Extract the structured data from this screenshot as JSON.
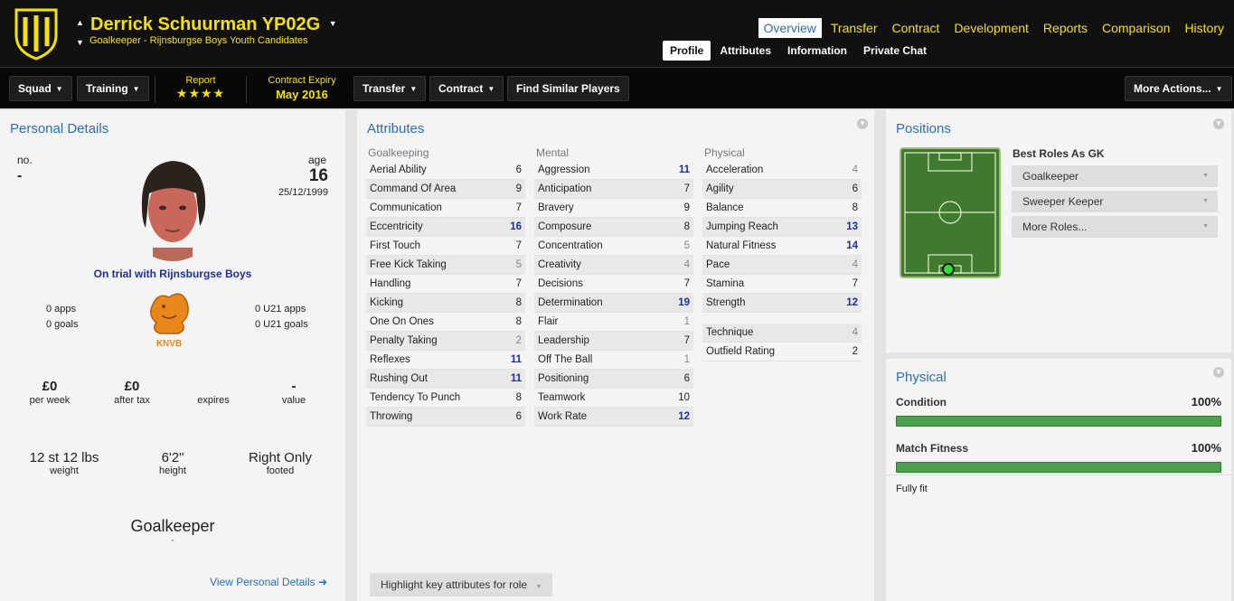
{
  "header": {
    "name": "Derrick Schuurman YP02G",
    "subtitle": "Goalkeeper - Rijnsburgse Boys Youth Candidates",
    "tabs": [
      {
        "label": "Overview",
        "active": true
      },
      {
        "label": "Transfer"
      },
      {
        "label": "Contract"
      },
      {
        "label": "Development"
      },
      {
        "label": "Reports"
      },
      {
        "label": "Comparison"
      },
      {
        "label": "History"
      }
    ],
    "subtabs": [
      {
        "label": "Profile",
        "active": true
      },
      {
        "label": "Attributes"
      },
      {
        "label": "Information"
      },
      {
        "label": "Private Chat"
      }
    ],
    "brand_color": "#f5e200"
  },
  "toolbar": {
    "squad": "Squad",
    "training": "Training",
    "report_label": "Report",
    "report_stars": "★★★★",
    "contract_label": "Contract Expiry",
    "contract_value": "May 2016",
    "transfer": "Transfer",
    "contract": "Contract",
    "find_similar": "Find Similar Players",
    "more_actions": "More Actions..."
  },
  "personal": {
    "title": "Personal Details",
    "no_label": "no.",
    "no_value": "-",
    "age_label": "age",
    "age_value": "16",
    "dob": "25/12/1999",
    "trial": "On trial with Rijnsburgse Boys",
    "apps": "0 apps",
    "goals": "0 goals",
    "u21_apps": "0 U21 apps",
    "u21_goals": "0 U21 goals",
    "badge_text": "KNVB",
    "wage": "£0",
    "wage_label": "per week",
    "after_tax": "£0",
    "after_tax_label": "after tax",
    "expires_label": "expires",
    "value": "-",
    "value_label": "value",
    "weight": "12 st 12 lbs",
    "weight_label": "weight",
    "height": "6'2\"",
    "height_label": "height",
    "foot": "Right Only",
    "foot_label": "footed",
    "position": "Goalkeeper",
    "position_sub": "-",
    "view_link": "View Personal Details ➜"
  },
  "attributes": {
    "title": "Attributes",
    "goalkeeping_head": "Goalkeeping",
    "mental_head": "Mental",
    "physical_head": "Physical",
    "goalkeeping": [
      {
        "name": "Aerial Ability",
        "value": "6"
      },
      {
        "name": "Command Of Area",
        "value": "9"
      },
      {
        "name": "Communication",
        "value": "7"
      },
      {
        "name": "Eccentricity",
        "value": "16",
        "level": "hi"
      },
      {
        "name": "First Touch",
        "value": "7"
      },
      {
        "name": "Free Kick Taking",
        "value": "5",
        "level": "lo"
      },
      {
        "name": "Handling",
        "value": "7"
      },
      {
        "name": "Kicking",
        "value": "8"
      },
      {
        "name": "One On Ones",
        "value": "8"
      },
      {
        "name": "Penalty Taking",
        "value": "2",
        "level": "lo"
      },
      {
        "name": "Reflexes",
        "value": "11",
        "level": "hi"
      },
      {
        "name": "Rushing Out",
        "value": "11",
        "level": "hi"
      },
      {
        "name": "Tendency To Punch",
        "value": "8"
      },
      {
        "name": "Throwing",
        "value": "6"
      }
    ],
    "mental": [
      {
        "name": "Aggression",
        "value": "11",
        "level": "hi"
      },
      {
        "name": "Anticipation",
        "value": "7"
      },
      {
        "name": "Bravery",
        "value": "9"
      },
      {
        "name": "Composure",
        "value": "8"
      },
      {
        "name": "Concentration",
        "value": "5",
        "level": "lo"
      },
      {
        "name": "Creativity",
        "value": "4",
        "level": "lo"
      },
      {
        "name": "Decisions",
        "value": "7"
      },
      {
        "name": "Determination",
        "value": "19",
        "level": "hi"
      },
      {
        "name": "Flair",
        "value": "1",
        "level": "lo"
      },
      {
        "name": "Leadership",
        "value": "7"
      },
      {
        "name": "Off The Ball",
        "value": "1",
        "level": "lo"
      },
      {
        "name": "Positioning",
        "value": "6"
      },
      {
        "name": "Teamwork",
        "value": "10"
      },
      {
        "name": "Work Rate",
        "value": "12",
        "level": "hi"
      }
    ],
    "physical": [
      {
        "name": "Acceleration",
        "value": "4",
        "level": "lo"
      },
      {
        "name": "Agility",
        "value": "6"
      },
      {
        "name": "Balance",
        "value": "8"
      },
      {
        "name": "Jumping Reach",
        "value": "13",
        "level": "hi"
      },
      {
        "name": "Natural Fitness",
        "value": "14",
        "level": "hi"
      },
      {
        "name": "Pace",
        "value": "4",
        "level": "lo"
      },
      {
        "name": "Stamina",
        "value": "7"
      },
      {
        "name": "Strength",
        "value": "12",
        "level": "hi"
      }
    ],
    "technique": {
      "name": "Technique",
      "value": "4"
    },
    "outfield": {
      "name": "Outfield Rating",
      "value": "2"
    },
    "highlight_button": "Highlight key attributes for role"
  },
  "positions": {
    "title": "Positions",
    "best_roles": "Best Roles As GK",
    "roles": [
      "Goalkeeper",
      "Sweeper Keeper",
      "More Roles..."
    ]
  },
  "physical": {
    "title": "Physical",
    "condition_label": "Condition",
    "condition_value": "100%",
    "condition_fraction": 1.0,
    "fitness_label": "Match Fitness",
    "fitness_value": "100%",
    "fitness_fraction": 1.0,
    "status": "Fully fit"
  }
}
